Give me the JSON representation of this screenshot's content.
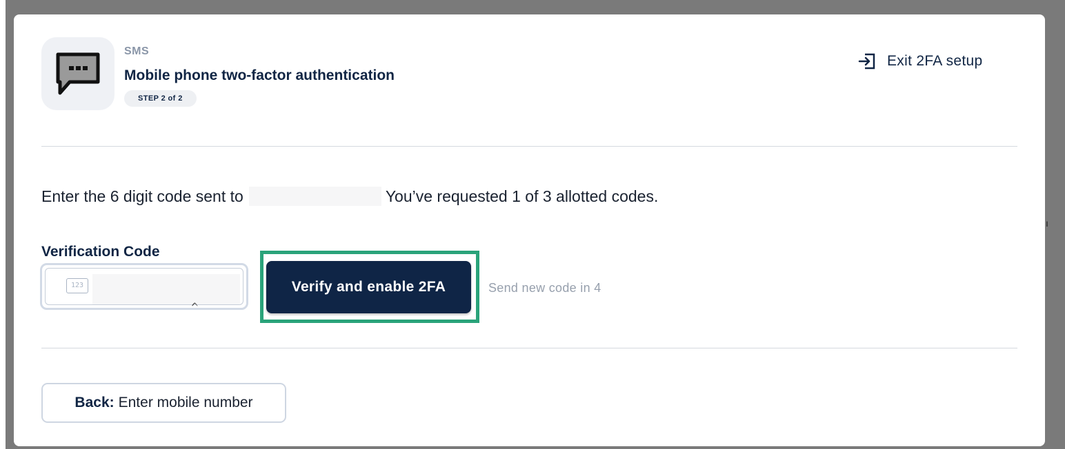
{
  "header": {
    "eyebrow": "SMS",
    "title": "Mobile phone two-factor authentication",
    "step_badge": "STEP 2 of 2",
    "icon": "chat-bubble-icon",
    "exit_label": "Exit 2FA setup",
    "exit_icon": "exit-arrow-icon"
  },
  "body": {
    "instruction_prefix": "Enter the 6 digit code sent to",
    "instruction_suffix": "You’ve requested 1 of 3 allotted codes.",
    "field_label": "Verification Code",
    "input_icon_text": "123",
    "input_value": "",
    "verify_label": "Verify and enable 2FA",
    "resend_text": "Send new code in 4"
  },
  "footer": {
    "back_bold": "Back:",
    "back_rest": "Enter mobile number"
  },
  "colors": {
    "brand_navy": "#0f2546",
    "highlight": "#2aa37a",
    "muted_text": "#97a0ad"
  },
  "backdrop_mark": "ı"
}
